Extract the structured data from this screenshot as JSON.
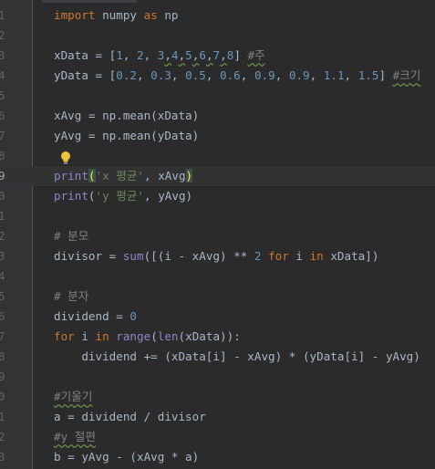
{
  "editor": {
    "line_numbers": [
      "1",
      "2",
      "3",
      "4",
      "5",
      "6",
      "7",
      "8",
      "9",
      "0",
      "1",
      "2",
      "3",
      "4",
      "5",
      "6",
      "7",
      "8",
      "9",
      "0",
      "1",
      "2",
      "3"
    ],
    "current_line_index": 8,
    "code": {
      "l1": {
        "kw_import": "import",
        "mod": " numpy ",
        "kw_as": "as",
        "alias": " np"
      },
      "l3": {
        "a": "xData = [",
        "n1": "1",
        "c1": ", ",
        "n2": "2",
        "c2": ", ",
        "n3": "3",
        "c3": ",",
        "n4": "4",
        "c4": ",",
        "n5": "5",
        "c5": ",",
        "n6": "6",
        "c6": ",",
        "n7": "7",
        "c7": ",",
        "n8": "8",
        "c8": "] ",
        "cmt": "#주"
      },
      "l4": {
        "a": "yData = [",
        "n1": "0.2",
        "c1": ", ",
        "n2": "0.3",
        "c2": ", ",
        "n3": "0.5",
        "c3": ", ",
        "n4": "0.6",
        "c4": ", ",
        "n5": "0.9",
        "c5": ", ",
        "n6": "0.9",
        "c6": ", ",
        "n7": "1.1",
        "c7": ", ",
        "n8": "1.5",
        "c8": "] ",
        "cmt": "#크기"
      },
      "l6": "xAvg = np.mean(xData)",
      "l7": "yAvg = np.mean(yData)",
      "l9": {
        "fn": "print",
        "p1": "(",
        "str": "'x 평균'",
        "rest": ", xAvg",
        "p2": ")"
      },
      "l10": {
        "fn": "print",
        "rest1": "(",
        "str": "'y 평균'",
        "rest2": ", yAvg)"
      },
      "l12": "# 분모",
      "l13": {
        "a": "divisor = ",
        "fn": "sum",
        "b": "([(i - xAvg) ** ",
        "n": "2",
        "c": " ",
        "kw_for": "for",
        "d": " i ",
        "kw_in": "in",
        "e": " xData])"
      },
      "l15": "# 분자",
      "l16": {
        "a": "dividend = ",
        "n": "0"
      },
      "l17": {
        "kw_for": "for",
        "a": " i ",
        "kw_in": "in",
        "b": " ",
        "fn1": "range",
        "c": "(",
        "fn2": "len",
        "d": "(xData)):"
      },
      "l18": "    dividend += (xData[i] - xAvg) * (yData[i] - yAvg)",
      "l20": "#기울기",
      "l21": "a = dividend / divisor",
      "l22": "#y 절편",
      "l23": "b = yAvg - (xAvg * a)"
    },
    "intention_icon": "lightbulb-icon",
    "colors": {
      "background": "#2b2b2b",
      "keyword": "#cc7832",
      "number": "#6897bb",
      "string": "#6a8759",
      "comment": "#808080",
      "builtin": "#8888c6",
      "text": "#a9b7c6"
    }
  }
}
